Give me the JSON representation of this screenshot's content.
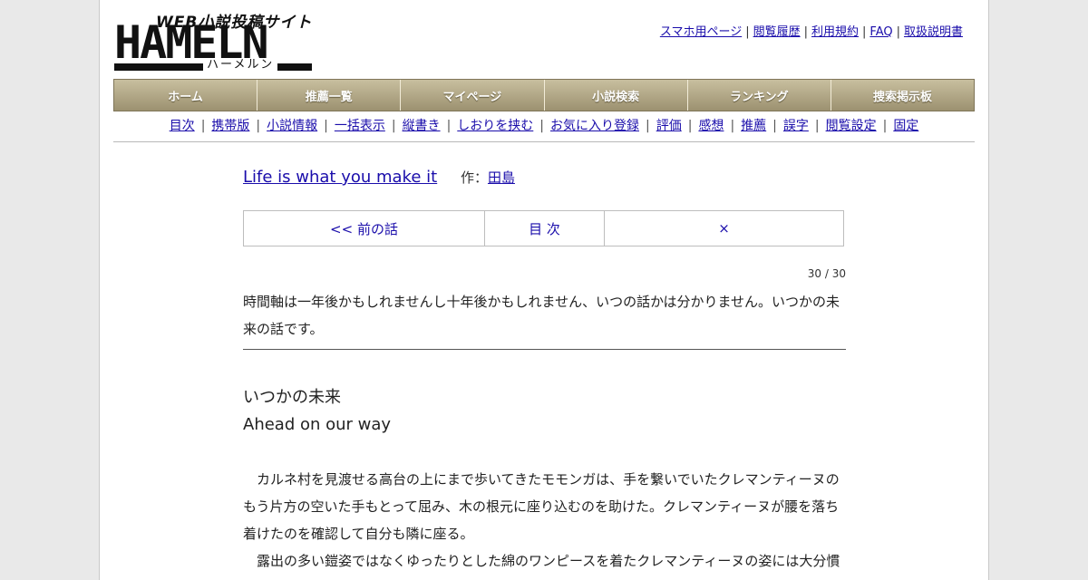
{
  "logo": {
    "tagline": "WEB小説投稿サイト",
    "wordmark": "HAMELN",
    "kana": "ハーメルン"
  },
  "top_links": [
    "スマホ用ページ",
    "閲覧履歴",
    "利用規約",
    "FAQ",
    "取扱説明書"
  ],
  "main_nav": [
    "ホーム",
    "推薦一覧",
    "マイページ",
    "小説検索",
    "ランキング",
    "捜索掲示板"
  ],
  "sub_nav": [
    "目次",
    "携帯版",
    "小説情報",
    "一括表示",
    "縦書き",
    "しおりを挟む",
    "お気に入り登録",
    "評価",
    "感想",
    "推薦",
    "誤字",
    "閲覧設定",
    "固定"
  ],
  "novel": {
    "title": "Life is what you make it",
    "author_prefix": "作：",
    "author": "田島"
  },
  "pager": {
    "prev": "<< 前の話",
    "toc": "目 次",
    "next": "×"
  },
  "episode_count": "30 / 30",
  "preface": "時間軸は一年後かもしれませんし十年後かもしれません、いつの話かは分かりません。いつかの未来の話です。",
  "chapter": {
    "title": "いつかの未来",
    "subtitle": "Ahead on our way"
  },
  "body": [
    "カルネ村を見渡せる高台の上にまで歩いてきたモモンガは、手を繋いでいたクレマンティーヌのもう片方の空いた手もとって屈み、木の根元に座り込むのを助けた。クレマンティーヌが腰を落ち着けたのを確認して自分も隣に座る。",
    "露出の多い鎧姿ではなくゆったりとした綿のワンピースを着たクレマンティーヌの姿には大分慣"
  ]
}
